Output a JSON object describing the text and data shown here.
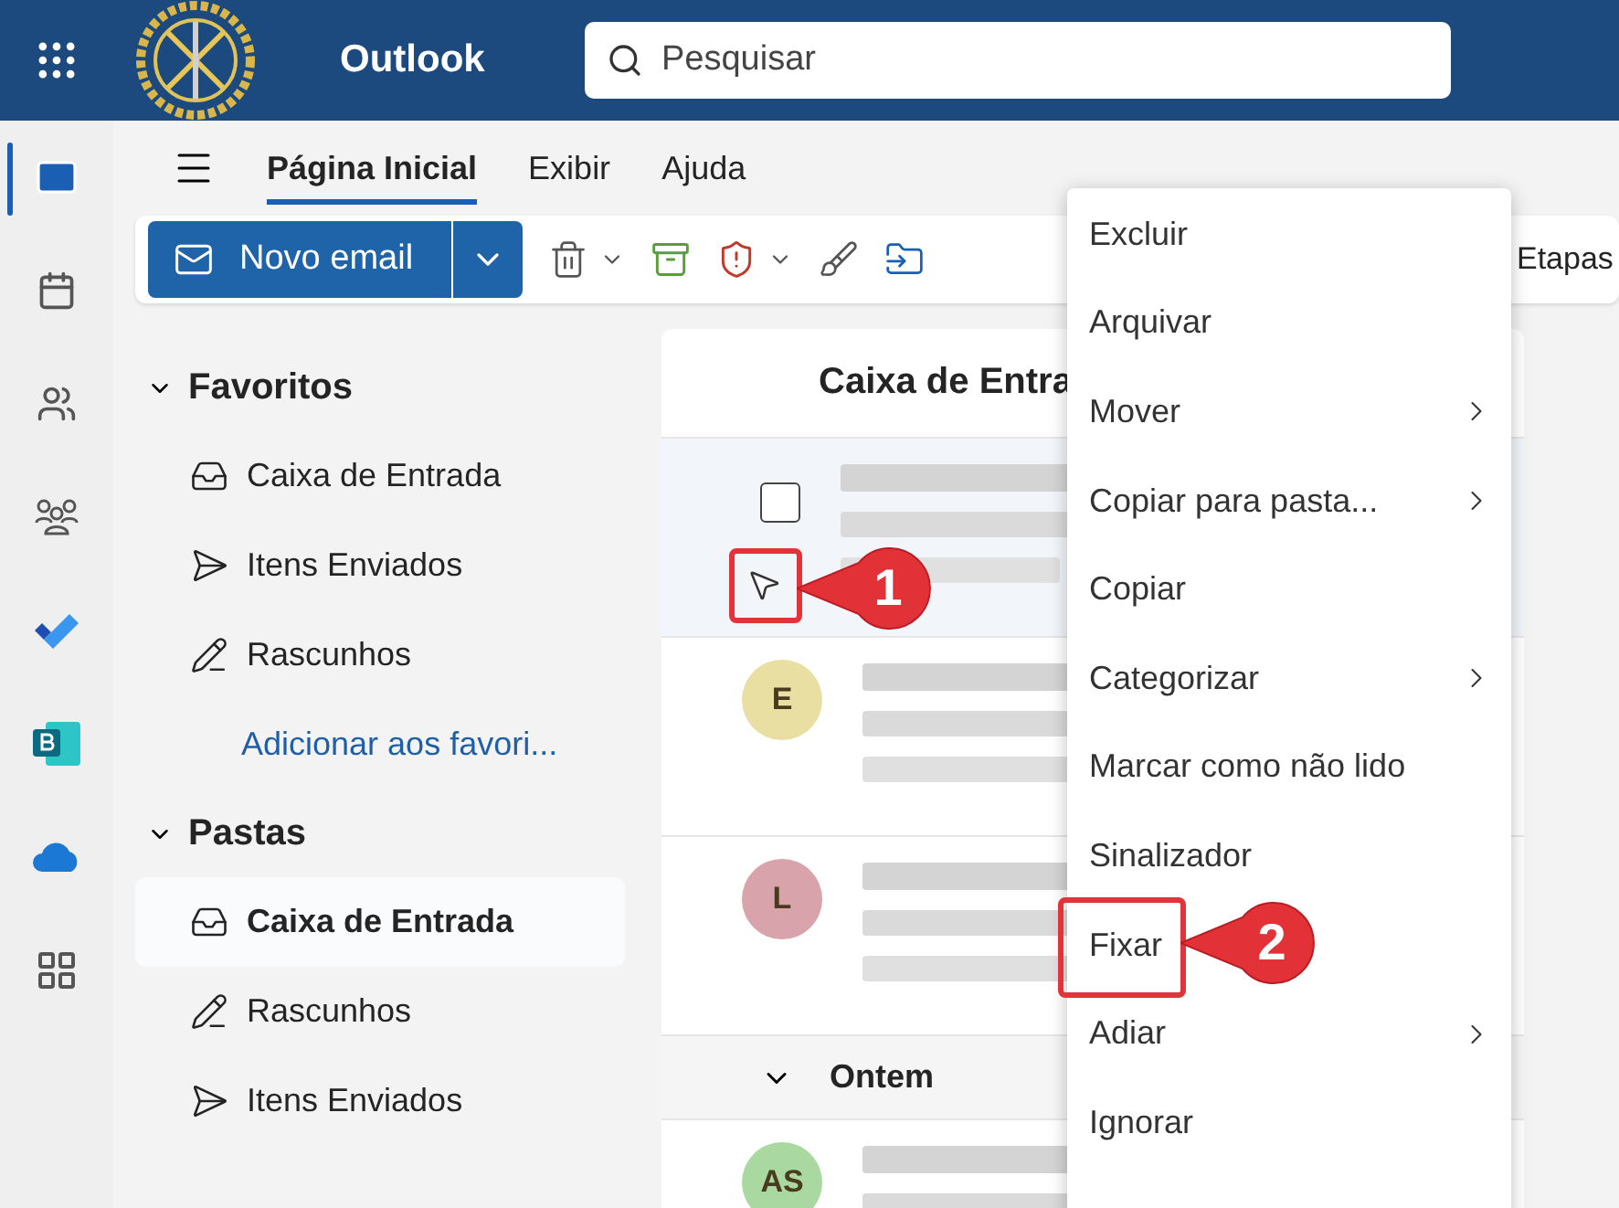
{
  "header": {
    "app_title": "Outlook",
    "search": {
      "placeholder": "Pesquisar"
    }
  },
  "rail": [
    {
      "kind": "mail",
      "selected": true
    },
    {
      "kind": "calendar",
      "selected": false
    },
    {
      "kind": "people",
      "selected": false
    },
    {
      "kind": "groups",
      "selected": false
    },
    {
      "kind": "todo",
      "selected": false
    },
    {
      "kind": "bookings",
      "selected": false
    },
    {
      "kind": "onedrive",
      "selected": false
    },
    {
      "kind": "apps",
      "selected": false
    }
  ],
  "tabs": [
    {
      "label": "Página Inicial",
      "selected": true
    },
    {
      "label": "Exibir",
      "selected": false
    },
    {
      "label": "Ajuda",
      "selected": false
    }
  ],
  "toolbar": {
    "new_button": "Novo email",
    "quick_steps": "Etapas"
  },
  "folder_sections": [
    {
      "title": "Favoritos",
      "expanded": true,
      "items": [
        {
          "kind": "inbox",
          "label": "Caixa de Entrada",
          "selected": false
        },
        {
          "kind": "sent",
          "label": "Itens Enviados",
          "selected": false
        },
        {
          "kind": "drafts",
          "label": "Rascunhos",
          "selected": false
        }
      ],
      "link": "Adicionar aos favori..."
    },
    {
      "title": "Pastas",
      "expanded": true,
      "items": [
        {
          "kind": "inbox",
          "label": "Caixa de Entrada",
          "selected": true
        },
        {
          "kind": "drafts",
          "label": "Rascunhos",
          "selected": false
        },
        {
          "kind": "sent",
          "label": "Itens Enviados",
          "selected": false
        }
      ]
    }
  ],
  "message_list": {
    "title": "Caixa de Entra",
    "messages": [
      {
        "kind": "checkbox",
        "checked": false,
        "selected": true
      },
      {
        "kind": "avatar",
        "initials": "E",
        "color": "#e9dfa3",
        "selected": false
      },
      {
        "kind": "avatar",
        "initials": "L",
        "color": "#d8a3ab",
        "selected": false
      }
    ],
    "group": {
      "label": "Ontem",
      "expanded": true
    },
    "more_messages": [
      {
        "kind": "avatar",
        "initials": "AS",
        "color": "#a9d8a1",
        "selected": false
      }
    ]
  },
  "context_menu": [
    {
      "label": "Excluir",
      "submenu": false
    },
    {
      "label": "Arquivar",
      "submenu": false
    },
    {
      "label": "Mover",
      "submenu": true
    },
    {
      "label": "Copiar para pasta...",
      "submenu": true
    },
    {
      "label": "Copiar",
      "submenu": false
    },
    {
      "label": "Categorizar",
      "submenu": true
    },
    {
      "label": "Marcar como não lido",
      "submenu": false
    },
    {
      "label": "Sinalizador",
      "submenu": false
    },
    {
      "label": "Fixar",
      "submenu": false
    },
    {
      "label": "Adiar",
      "submenu": true
    },
    {
      "label": "Ignorar",
      "submenu": false
    }
  ],
  "annotations": [
    {
      "number": "1"
    },
    {
      "number": "2"
    }
  ]
}
